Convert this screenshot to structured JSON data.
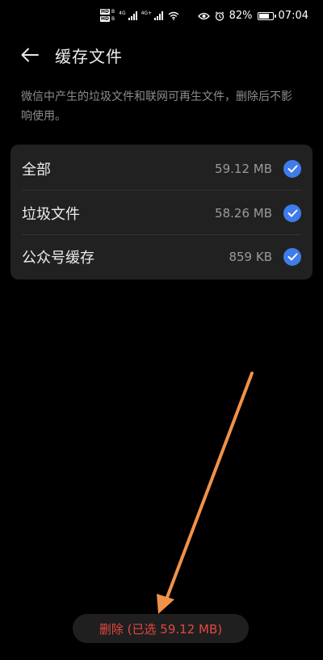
{
  "status_bar": {
    "hd1": "HD",
    "hd1_sub": "B",
    "hd2": "HD",
    "hd2_sub": "B",
    "net1": "4G",
    "net2": "4G+",
    "battery_percent": "82%",
    "time": "07:04",
    "battery_level": 0.82
  },
  "header": {
    "title": "缓存文件"
  },
  "description": "微信中产生的垃圾文件和联网可再生文件，删除后不影响使用。",
  "items": [
    {
      "label": "全部",
      "size": "59.12 MB",
      "checked": true
    },
    {
      "label": "垃圾文件",
      "size": "58.26 MB",
      "checked": true
    },
    {
      "label": "公众号缓存",
      "size": "859 KB",
      "checked": true
    }
  ],
  "delete_button": {
    "label": "删除 (已选 59.12 MB)"
  },
  "colors": {
    "accent_check": "#3f7bea",
    "delete_text": "#e5473f",
    "annotation_arrow": "#f0924a"
  }
}
